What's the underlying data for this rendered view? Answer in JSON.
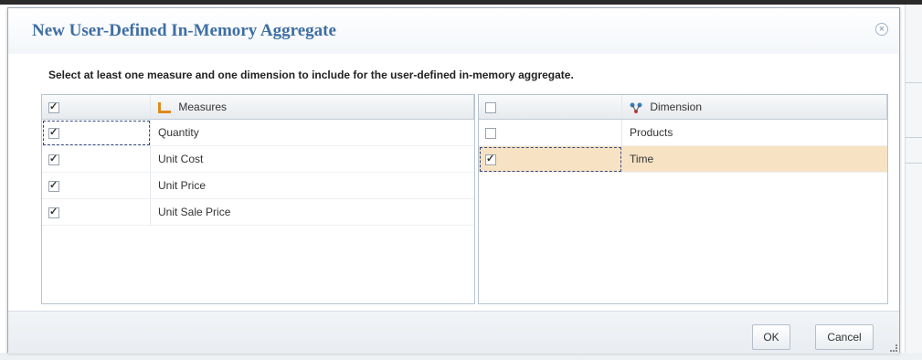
{
  "dialog": {
    "title": "New User-Defined In-Memory Aggregate",
    "instruction": "Select at least one measure and one dimension to include for the user-defined in-memory aggregate.",
    "close_icon": "close-icon"
  },
  "measures": {
    "header": "Measures",
    "header_checked": true,
    "icon": "measures-icon",
    "rows": [
      {
        "label": "Quantity",
        "checked": true
      },
      {
        "label": "Unit Cost",
        "checked": true
      },
      {
        "label": "Unit Price",
        "checked": true
      },
      {
        "label": "Unit Sale Price",
        "checked": true
      }
    ]
  },
  "dimensions": {
    "header": "Dimension",
    "header_checked": false,
    "icon": "dimension-icon",
    "rows": [
      {
        "label": "Products",
        "checked": false
      },
      {
        "label": "Time",
        "checked": true,
        "selected": true
      }
    ]
  },
  "buttons": {
    "ok": "OK",
    "cancel": "Cancel"
  },
  "colors": {
    "title": "#3f6ea3",
    "selected_row": "#f7e3c3",
    "panel_border": "#b7c3cf"
  }
}
